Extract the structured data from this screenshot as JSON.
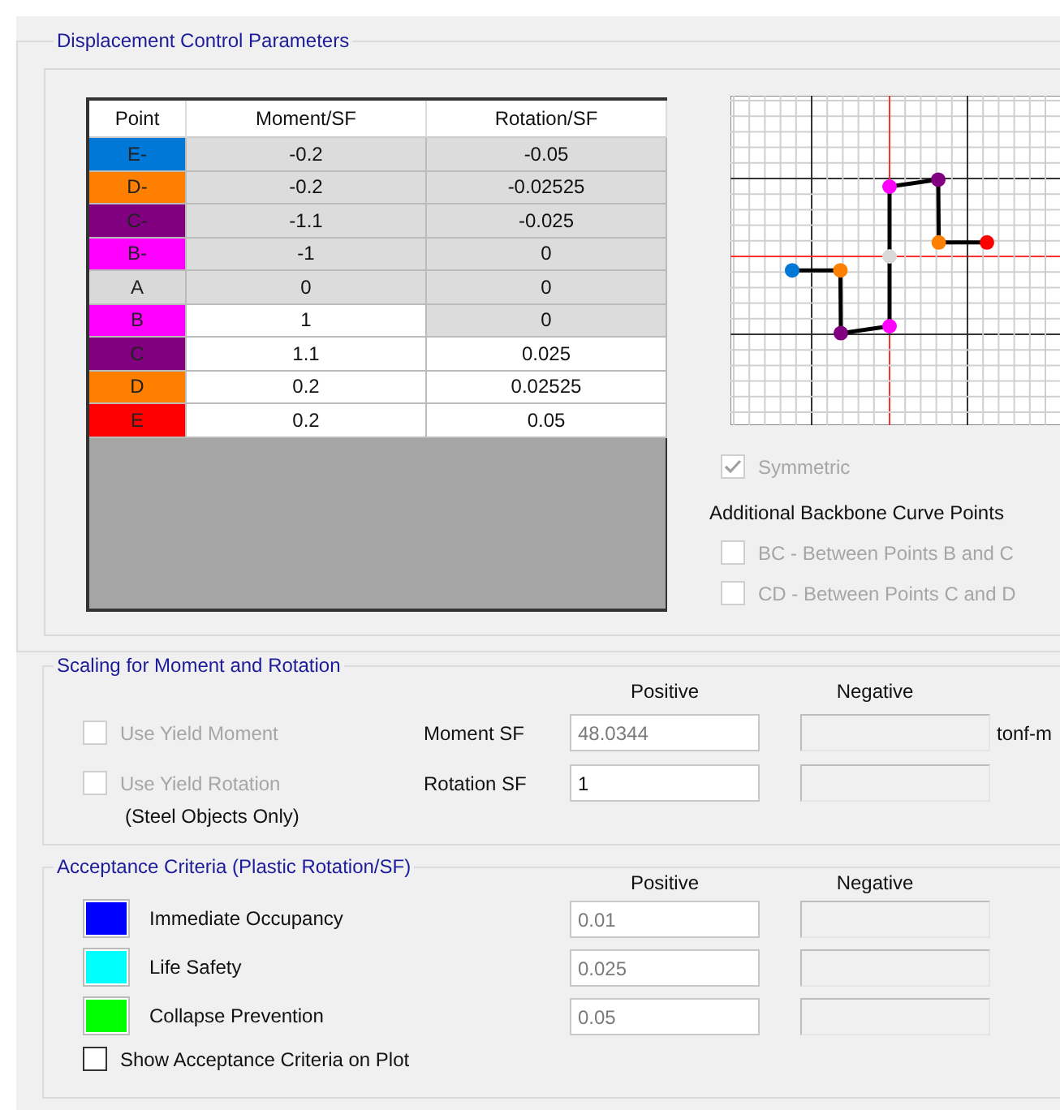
{
  "displacement": {
    "title": "Displacement Control Parameters",
    "table": {
      "columns": [
        "Point",
        "Moment/SF",
        "Rotation/SF"
      ],
      "rows": [
        {
          "point": "E-",
          "color": "#0078d7",
          "moment": {
            "value": "-0.2",
            "disabled": true
          },
          "rotation": {
            "value": "-0.05",
            "disabled": true
          }
        },
        {
          "point": "D-",
          "color": "#ff8000",
          "moment": {
            "value": "-0.2",
            "disabled": true
          },
          "rotation": {
            "value": "-0.02525",
            "disabled": true
          }
        },
        {
          "point": "C-",
          "color": "#800080",
          "moment": {
            "value": "-1.1",
            "disabled": true
          },
          "rotation": {
            "value": "-0.025",
            "disabled": true
          }
        },
        {
          "point": "B-",
          "color": "#ff00ff",
          "moment": {
            "value": "-1",
            "disabled": true
          },
          "rotation": {
            "value": "0",
            "disabled": true
          }
        },
        {
          "point": "A",
          "color": "#d9d9d9",
          "moment": {
            "value": "0",
            "disabled": true
          },
          "rotation": {
            "value": "0",
            "disabled": true
          }
        },
        {
          "point": "B",
          "color": "#ff00ff",
          "moment": {
            "value": "1",
            "disabled": false
          },
          "rotation": {
            "value": "0",
            "disabled": true
          }
        },
        {
          "point": "C",
          "color": "#800080",
          "moment": {
            "value": "1.1",
            "disabled": false
          },
          "rotation": {
            "value": "0.025",
            "disabled": false
          }
        },
        {
          "point": "D",
          "color": "#ff8000",
          "moment": {
            "value": "0.2",
            "disabled": false
          },
          "rotation": {
            "value": "0.02525",
            "disabled": false
          }
        },
        {
          "point": "E",
          "color": "#ff0000",
          "moment": {
            "value": "0.2",
            "disabled": false
          },
          "rotation": {
            "value": "0.05",
            "disabled": false
          }
        }
      ]
    },
    "symmetric": {
      "label": "Symmetric",
      "checked": true,
      "disabled": true
    },
    "additional": {
      "title": "Additional Backbone Curve Points",
      "options": [
        {
          "label": "BC - Between Points B and C",
          "checked": false,
          "disabled": true
        },
        {
          "label": "CD - Between Points C and D",
          "checked": false,
          "disabled": true
        }
      ]
    }
  },
  "scaling": {
    "title": "Scaling for Moment and Rotation",
    "headers": [
      "Positive",
      "Negative"
    ],
    "rows": [
      {
        "option": {
          "label": "Use Yield Moment",
          "checked": false,
          "disabled": true
        },
        "label": "Moment SF",
        "positive": {
          "value": "48.0344",
          "greyed": true,
          "disabled": false
        },
        "negative": {
          "disabled": true
        },
        "unit": "tonf-m"
      },
      {
        "option": {
          "label": "Use Yield Rotation",
          "checked": false,
          "disabled": true
        },
        "note": "(Steel Objects Only)",
        "label": "Rotation SF",
        "positive": {
          "value": "1",
          "greyed": false,
          "disabled": false
        },
        "negative": {
          "disabled": true
        }
      }
    ]
  },
  "acceptance": {
    "title": "Acceptance Criteria (Plastic Rotation/SF)",
    "headers": [
      "Positive",
      "Negative"
    ],
    "rows": [
      {
        "label": "Immediate Occupancy",
        "color": "#0000ff",
        "positive": {
          "value": "0.01",
          "greyed": true,
          "disabled": false
        },
        "negative": {
          "disabled": true
        }
      },
      {
        "label": "Life Safety",
        "color": "#00ffff",
        "positive": {
          "value": "0.025",
          "greyed": true,
          "disabled": false
        },
        "negative": {
          "disabled": true
        }
      },
      {
        "label": "Collapse Prevention",
        "color": "#00ff00",
        "positive": {
          "value": "0.05",
          "greyed": true,
          "disabled": false
        },
        "negative": {
          "disabled": true
        }
      }
    ],
    "show_on_plot": {
      "label": "Show Acceptance Criteria on Plot",
      "checked": false,
      "disabled": false
    }
  }
}
